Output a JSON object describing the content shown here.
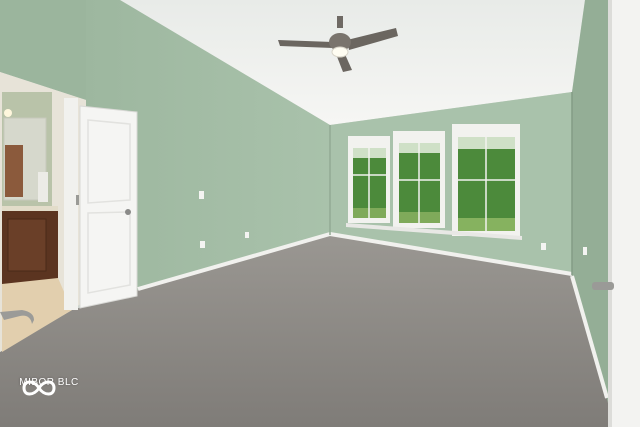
{
  "scene": {
    "description_free": true,
    "colors": {
      "wall_green": "#9fb9a3",
      "wall_green_light": "#b3cab5",
      "ceiling": "#f0f1ef",
      "carpet": "#8d8a86",
      "trim": "#f4f4f2",
      "door": "#f5f5f3",
      "cabinet": "#5b3420",
      "foliage": "#4c8a3b"
    },
    "icons": {
      "ceiling_fan": "ceiling-fan-icon",
      "watermark_logo": "infinity-logo-icon"
    }
  },
  "watermark": {
    "text": "MIBOR BLC"
  }
}
